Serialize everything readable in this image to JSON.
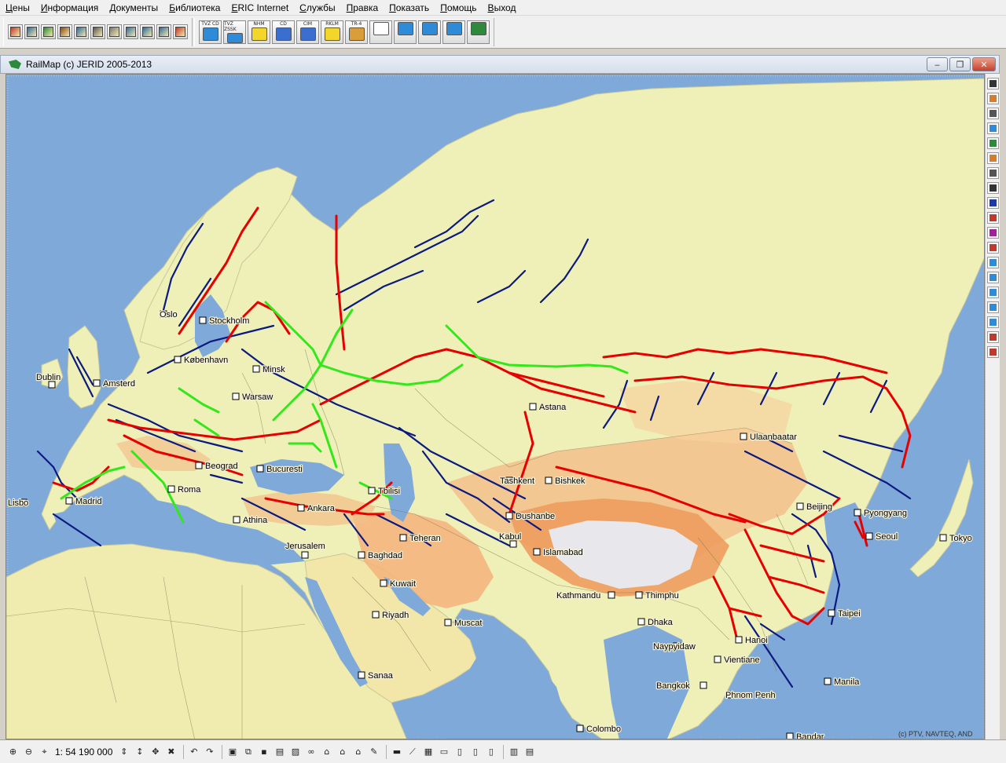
{
  "menu": [
    "Цены",
    "Информация",
    "Документы",
    "Библиотека",
    "ERIC Internet",
    "Службы",
    "Правка",
    "Показать",
    "Помощь",
    "Выход"
  ],
  "toolbar": {
    "small_icons": [
      "new-document-icon",
      "table-icon",
      "open-icon",
      "train-icon",
      "search-icon",
      "print-preview-icon",
      "copy-icon",
      "list-icon",
      "grid-icon",
      "calendar-icon",
      "exit-icon"
    ],
    "large_buttons": [
      {
        "label": "TVZ CD",
        "icon": "tvz-cd-icon"
      },
      {
        "label": "TVZ ZSSK",
        "icon": "tvz-zssk-icon"
      },
      {
        "label": "NHM",
        "icon": "nhm-icon"
      },
      {
        "label": "CD",
        "icon": "cd-icon"
      },
      {
        "label": "CIM",
        "icon": "cim-icon"
      },
      {
        "label": "RKLM",
        "icon": "rklm-icon"
      },
      {
        "label": "TR-4",
        "icon": "tr4-icon"
      },
      {
        "label": "",
        "icon": "blank-icon"
      },
      {
        "label": "",
        "icon": "calculator-edit-icon"
      },
      {
        "label": "",
        "icon": "calculator-icon"
      },
      {
        "label": "",
        "icon": "calculator-2-icon"
      },
      {
        "label": "",
        "icon": "map-icon"
      }
    ]
  },
  "window": {
    "title": "RailMap (c) JERID 2005-2013",
    "minimize": "‒",
    "restore": "❐",
    "close": "✕"
  },
  "map": {
    "copyright": "(c) PTV, NAVTEQ, AND",
    "cities": [
      {
        "name": "Stockholm"
      },
      {
        "name": "Dublin"
      },
      {
        "name": "Amsterd"
      },
      {
        "name": "København"
      },
      {
        "name": "Minsk"
      },
      {
        "name": "Warsaw"
      },
      {
        "name": "Lisbo"
      },
      {
        "name": "Madrid"
      },
      {
        "name": "Roma"
      },
      {
        "name": "Beograd"
      },
      {
        "name": "Bucuresti"
      },
      {
        "name": "Athina"
      },
      {
        "name": "Ankara"
      },
      {
        "name": "Tbilisi"
      },
      {
        "name": "Astana"
      },
      {
        "name": "Tashkent"
      },
      {
        "name": "Bishkek"
      },
      {
        "name": "Dushanbe"
      },
      {
        "name": "Teheran"
      },
      {
        "name": "Kabul"
      },
      {
        "name": "Islamabad"
      },
      {
        "name": "Jerusalem"
      },
      {
        "name": "Baghdad"
      },
      {
        "name": "Kuwait"
      },
      {
        "name": "Riyadh"
      },
      {
        "name": "Muscat"
      },
      {
        "name": "Sanaa"
      },
      {
        "name": "Kathmandu"
      },
      {
        "name": "Thimphu"
      },
      {
        "name": "Dhaka"
      },
      {
        "name": "Naypyidaw"
      },
      {
        "name": "Hanoi"
      },
      {
        "name": "Vientiane"
      },
      {
        "name": "Bangkok"
      },
      {
        "name": "Phnom Penh"
      },
      {
        "name": "Colombo"
      },
      {
        "name": "Bandar"
      },
      {
        "name": "Ulaanbaatar"
      },
      {
        "name": "Beijing"
      },
      {
        "name": "Pyongyang"
      },
      {
        "name": "Seoul"
      },
      {
        "name": "Tokyo"
      },
      {
        "name": "Taipei"
      },
      {
        "name": "Manila"
      },
      {
        "name": "Oslo"
      }
    ]
  },
  "vtoolbar_icons": [
    "hatch-icon",
    "ruler-icon",
    "graph-icon",
    "layers-icon",
    "terrain-icon",
    "legend-icon",
    "chart-icon",
    "line-icon",
    "flag-icon",
    "red-dot-icon",
    "pin-icon",
    "red-line-icon",
    "page-icon",
    "copy-page-icon",
    "check-icon",
    "forward-icon",
    "forward-2-icon",
    "cut-icon",
    "delete-icon"
  ],
  "status": {
    "scale_label": "1: 54 190 000"
  }
}
